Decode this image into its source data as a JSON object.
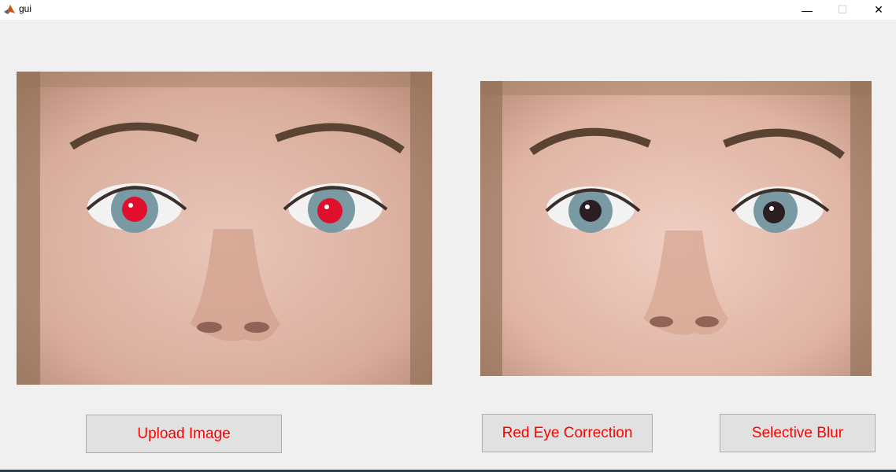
{
  "window": {
    "title": "gui",
    "icon": "matlab-icon",
    "controls": {
      "minimize_glyph": "—",
      "maximize_glyph": "☐",
      "close_glyph": "✕"
    }
  },
  "panels": {
    "original": {
      "content": "face with red-eye"
    },
    "corrected": {
      "content": "face with corrected eyes"
    }
  },
  "buttons": {
    "upload_label": "Upload Image",
    "red_eye_label": "Red Eye Correction",
    "blur_label": "Selective Blur"
  },
  "colors": {
    "button_text": "#ff0000",
    "background": "#f0f0f0",
    "button_face": "#e1e1e1"
  }
}
